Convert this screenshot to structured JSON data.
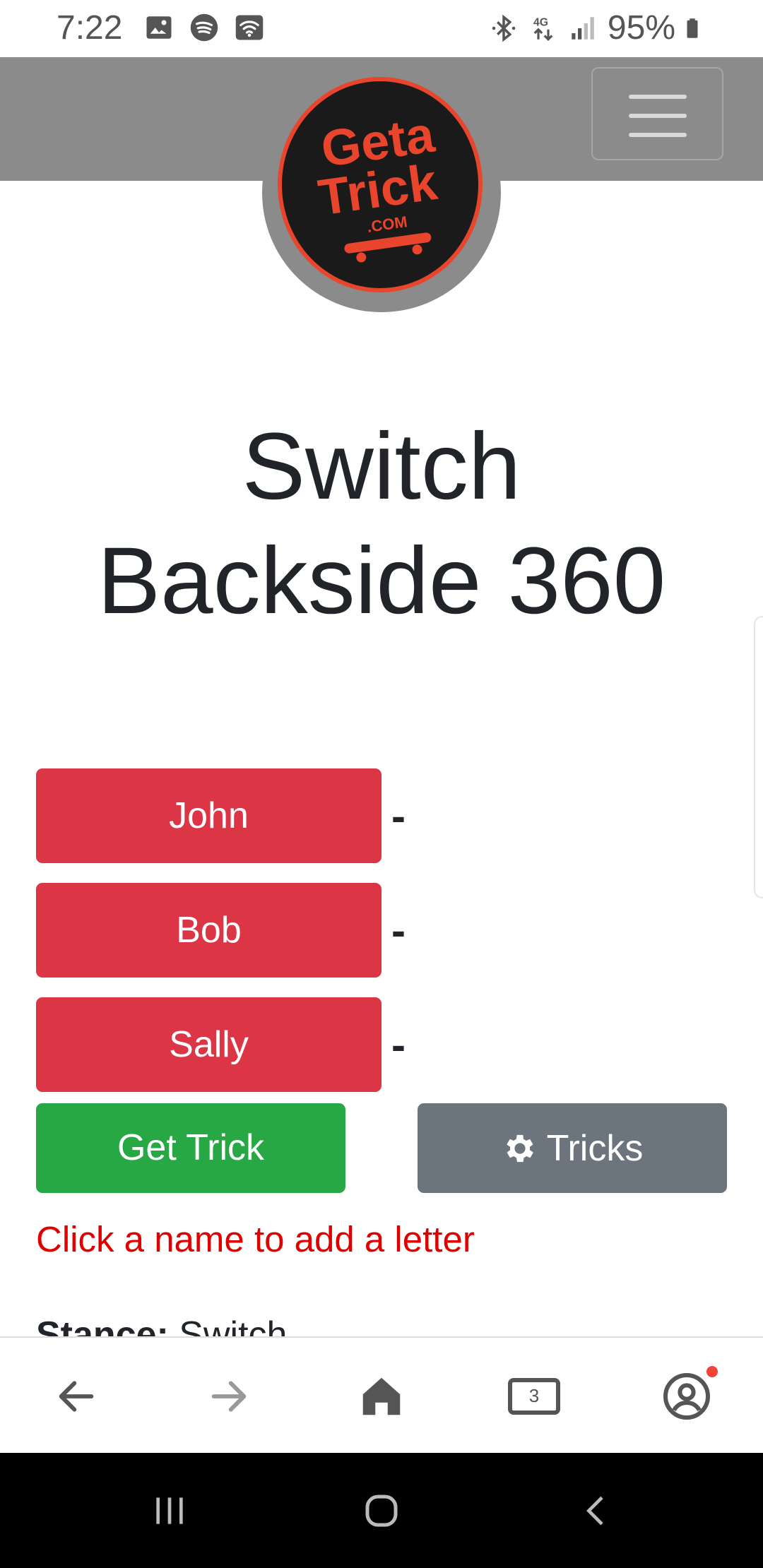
{
  "status_bar": {
    "time": "7:22",
    "battery": "95%",
    "left_icons": [
      "gallery-icon",
      "spotify-icon",
      "wifi-icon"
    ],
    "right_icons": [
      "bluetooth-icon",
      "4g-icon",
      "signal-icon",
      "battery-icon"
    ]
  },
  "navbar": {
    "logo_text": "Geta Trick .com",
    "menu_icon": "hamburger-menu-icon"
  },
  "trick": {
    "title_line1": "Switch",
    "title_line2": "Backside 360"
  },
  "players": [
    {
      "name": "John",
      "letters": "-"
    },
    {
      "name": "Bob",
      "letters": "-"
    },
    {
      "name": "Sally",
      "letters": "-"
    }
  ],
  "actions": {
    "get_trick": "Get Trick",
    "tricks": "Tricks",
    "tricks_icon": "gear-icon"
  },
  "hint": "Click a name to add a letter",
  "stance": {
    "label": "Stance:",
    "value": "Switch"
  },
  "browser_bar": {
    "items": [
      "back-arrow-icon",
      "forward-arrow-icon",
      "home-icon",
      "tabs-icon",
      "account-icon"
    ],
    "tab_count": "3"
  },
  "colors": {
    "navbar": "#8b8b8b",
    "player_button": "#dc3545",
    "get_trick_button": "#28a745",
    "tricks_button": "#6c757d",
    "hint": "#e00000"
  }
}
